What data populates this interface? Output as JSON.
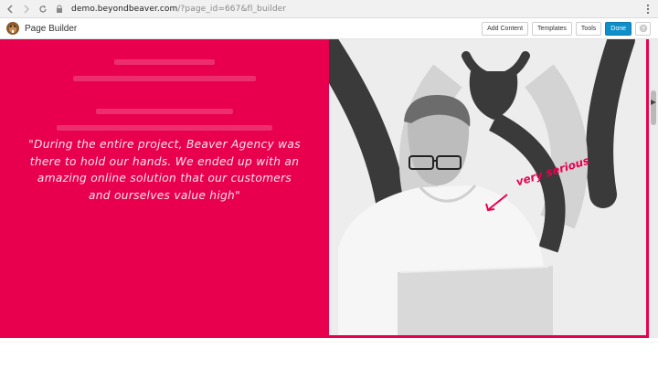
{
  "browser": {
    "url_host": "demo.beyondbeaver.com",
    "url_path": "/?page_id=667&fl_builder"
  },
  "builder": {
    "title": "Page Builder",
    "buttons": {
      "add_content": "Add Content",
      "templates": "Templates",
      "tools": "Tools",
      "done": "Done"
    }
  },
  "hero": {
    "quote": "\"During the entire project, Beaver Agency was there to hold our hands. We ended up with an amazing online solution that our customers and ourselves value high\"",
    "annotation": "very serious"
  },
  "colors": {
    "accent": "#e8004f",
    "done_button": "#0e8fc9"
  },
  "icons": [
    "back-icon",
    "forward-icon",
    "reload-icon",
    "lock-icon",
    "more-icon",
    "beaver-logo-icon",
    "help-icon",
    "arrow-icon"
  ]
}
